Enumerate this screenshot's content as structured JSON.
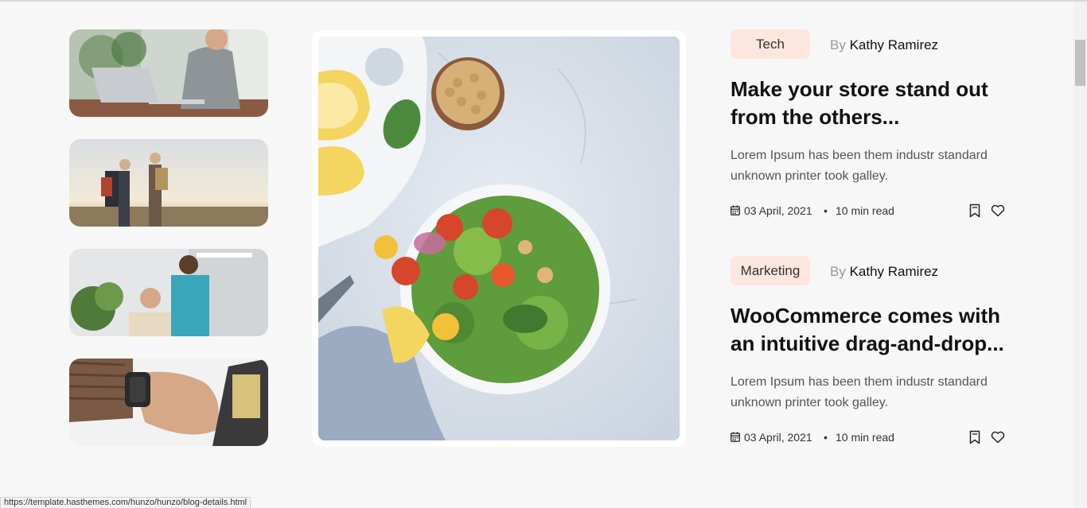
{
  "thumbnails": [
    {
      "alt": "man working on laptop"
    },
    {
      "alt": "two hikers with backpacks"
    },
    {
      "alt": "nurse with elderly patient"
    },
    {
      "alt": "hand with smart watch"
    }
  ],
  "hero": {
    "alt": "salad bowl with chickpeas and lemons"
  },
  "posts": [
    {
      "tag": "Tech",
      "by": "By",
      "author": "Kathy Ramirez",
      "title": "Make your store stand out from the others...",
      "excerpt": "Lorem Ipsum has been them industr standard unknown printer took galley.",
      "date": "03 April, 2021",
      "separator": "•",
      "read": "10 min read"
    },
    {
      "tag": "Marketing",
      "by": "By",
      "author": "Kathy Ramirez",
      "title": "WooCommerce comes with an intuitive drag-and-drop...",
      "excerpt": "Lorem Ipsum has been them industr standard unknown printer took galley.",
      "date": "03 April, 2021",
      "separator": "•",
      "read": "10 min read"
    }
  ],
  "status_url": "https://template.hasthemes.com/hunzo/hunzo/blog-details.html",
  "colors": {
    "tag_bg": "#fde6dd",
    "page_bg": "#f7f7f7",
    "title": "#111111"
  }
}
